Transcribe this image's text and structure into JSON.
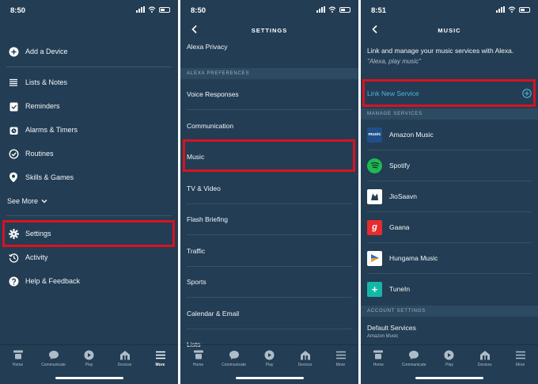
{
  "panel1": {
    "time": "8:50",
    "menu": [
      {
        "label": "Add a Device",
        "icon": "plus-circle-icon"
      },
      {
        "label": "Lists & Notes",
        "icon": "list-icon"
      },
      {
        "label": "Reminders",
        "icon": "reminder-icon"
      },
      {
        "label": "Alarms & Timers",
        "icon": "alarm-icon"
      },
      {
        "label": "Routines",
        "icon": "routine-icon"
      },
      {
        "label": "Skills & Games",
        "icon": "location-pin-icon"
      },
      {
        "label": "Settings",
        "icon": "gear-icon"
      },
      {
        "label": "Activity",
        "icon": "history-icon"
      },
      {
        "label": "Help & Feedback",
        "icon": "help-icon"
      }
    ],
    "see_more": "See More",
    "tabs": [
      "Home",
      "Communicate",
      "Play",
      "Devices",
      "More"
    ],
    "active_tab": "More"
  },
  "panel2": {
    "time": "8:50",
    "title": "SETTINGS",
    "rows_top": [
      "Alexa Privacy"
    ],
    "section": "ALEXA PREFERENCES",
    "rows": [
      "Voice Responses",
      "Communication",
      "Music",
      "TV & Video",
      "Flash Briefing",
      "Traffic",
      "Sports",
      "Calendar & Email",
      "Lists"
    ],
    "tabs": [
      "Home",
      "Communicate",
      "Play",
      "Devices",
      "More"
    ]
  },
  "panel3": {
    "time": "8:51",
    "title": "MUSIC",
    "intro": "Link and manage your music services with Alexa.",
    "intro_sub": "\"Alexa, play music\"",
    "link_new": "Link New Service",
    "manage_header": "MANAGE SERVICES",
    "services": [
      {
        "name": "Amazon Music",
        "color": "#1e4f8a",
        "glyph": "music"
      },
      {
        "name": "Spotify",
        "color": "#1db954",
        "glyph": ""
      },
      {
        "name": "JioSaavn",
        "color": "#ffffff",
        "glyph": ""
      },
      {
        "name": "Gaana",
        "color": "#e72c30",
        "glyph": "g"
      },
      {
        "name": "Hungama Music",
        "color": "#2a6ec0",
        "glyph": ""
      },
      {
        "name": "TuneIn",
        "color": "#14b8a6",
        "glyph": "+"
      }
    ],
    "account_header": "ACCOUNT SETTINGS",
    "default_title": "Default Services",
    "default_sub": "Amazon Music",
    "tabs": [
      "Home",
      "Communicate",
      "Play",
      "Devices",
      "More"
    ]
  }
}
